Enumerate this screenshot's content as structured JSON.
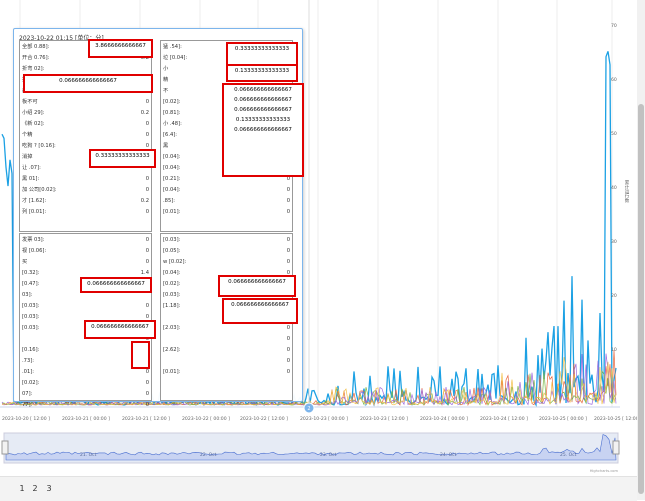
{
  "tooltip": {
    "header": "2023-10-22 01:15 [单位：分]",
    "tables": [
      {
        "rows": [
          {
            "label": "全部",
            "suffix": "0.88]:",
            "value": ""
          },
          {
            "label": "开合",
            "suffix": "0.76]:",
            "value": "0.2"
          },
          {
            "label": "折弯",
            "suffix": "02]:",
            "value": ""
          },
          {
            "label": "拒绝",
            "suffix": "0.02]:",
            "value": ""
          },
          {
            "label": "疯狂",
            "suffix": "32]:",
            "value": "0"
          },
          {
            "label": "板不可",
            "suffix": "",
            "value": "0"
          },
          {
            "label": "小绍",
            "suffix": "29]:",
            "value": "0.2"
          },
          {
            "label": "《新",
            "suffix": "02]:",
            "value": "0"
          },
          {
            "label": "个精",
            "suffix": "",
            "value": "0"
          },
          {
            "label": "吃狗",
            "suffix": "? [0.16]:",
            "value": "0"
          },
          {
            "label": "消掉",
            "suffix": "",
            "value": "0"
          },
          {
            "label": "让",
            "suffix": ".07]:",
            "value": ""
          },
          {
            "label": "黑",
            "suffix": "01]:",
            "value": "0"
          },
          {
            "label": "加",
            "suffix": "公司[0.02]:",
            "value": "0"
          },
          {
            "label": "才",
            "suffix": "[1.62]:",
            "value": "0.2"
          },
          {
            "label": "列",
            "suffix": "[0.01]:",
            "value": "0"
          }
        ]
      },
      {
        "rows": [
          {
            "label": "猛",
            "suffix": ".54]:",
            "value": ""
          },
          {
            "label": "垃",
            "suffix": "[0.04]:",
            "value": ""
          },
          {
            "label": "小",
            "suffix": "",
            "value": ""
          },
          {
            "label": "精",
            "suffix": "",
            "value": ""
          },
          {
            "label": "不",
            "suffix": "",
            "value": ""
          },
          {
            "label": "",
            "suffix": "[0.02]:",
            "value": ""
          },
          {
            "label": "",
            "suffix": "[0.81]:",
            "value": ""
          },
          {
            "label": "小",
            "suffix": ".48]:",
            "value": ""
          },
          {
            "label": "",
            "suffix": "[6.4]:",
            "value": ""
          },
          {
            "label": "黑",
            "suffix": "",
            "value": ""
          },
          {
            "label": "",
            "suffix": "[0.04]:",
            "value": "0"
          },
          {
            "label": "",
            "suffix": "[0.04]:",
            "value": "0"
          },
          {
            "label": "",
            "suffix": "[0.21]:",
            "value": "0"
          },
          {
            "label": "",
            "suffix": "[0.04]:",
            "value": "0"
          },
          {
            "label": "",
            "suffix": ".85]:",
            "value": "0"
          },
          {
            "label": "",
            "suffix": "[0.01]:",
            "value": "0"
          }
        ]
      },
      {
        "rows": [
          {
            "label": "发票",
            "suffix": "03]:",
            "value": "0"
          },
          {
            "label": "视",
            "suffix": "[0.06]:",
            "value": "0"
          },
          {
            "label": "买",
            "suffix": "",
            "value": "0"
          },
          {
            "label": "",
            "suffix": "[0.32]:",
            "value": "1.4"
          },
          {
            "label": "",
            "suffix": "[0.47]:",
            "value": ""
          },
          {
            "label": "",
            "suffix": "03]:",
            "value": ""
          },
          {
            "label": "",
            "suffix": "[0.03]:",
            "value": "0"
          },
          {
            "label": "",
            "suffix": "[0.03]:",
            "value": "0"
          },
          {
            "label": "",
            "suffix": "[0.03]:",
            "value": ""
          },
          {
            "label": "",
            "suffix": "",
            "value": "0"
          },
          {
            "label": "",
            "suffix": "[0.16]:",
            "value": "0.2"
          },
          {
            "label": "",
            "suffix": ".73]:",
            "value": "0.2"
          },
          {
            "label": "",
            "suffix": ".01]:",
            "value": "0"
          },
          {
            "label": "",
            "suffix": "[0.02]:",
            "value": "0"
          },
          {
            "label": "",
            "suffix": "07]:",
            "value": "0"
          },
          {
            "label": "",
            "suffix": "77]:",
            "value": "0"
          }
        ]
      },
      {
        "rows": [
          {
            "label": "",
            "suffix": "[0.03]:",
            "value": "0"
          },
          {
            "label": "",
            "suffix": "[0.05]:",
            "value": "0"
          },
          {
            "label": "",
            "suffix": "w [0.02]:",
            "value": "0"
          },
          {
            "label": "",
            "suffix": "[0.04]:",
            "value": "0"
          },
          {
            "label": "",
            "suffix": "[0.02]:",
            "value": ""
          },
          {
            "label": "",
            "suffix": "[0.03]:",
            "value": ""
          },
          {
            "label": "",
            "suffix": "[1.18]:",
            "value": ""
          },
          {
            "label": "",
            "suffix": "",
            "value": ""
          },
          {
            "label": "",
            "suffix": "[2.03]:",
            "value": "0"
          },
          {
            "label": "",
            "suffix": "",
            "value": "0"
          },
          {
            "label": "",
            "suffix": "[2.62]:",
            "value": "0"
          },
          {
            "label": "",
            "suffix": "",
            "value": "0"
          },
          {
            "label": "",
            "suffix": "[0.01]:",
            "value": "0"
          }
        ]
      }
    ],
    "highlights": [
      "3.8666666666667",
      "0.066666666666667",
      "0.33333333333333",
      "0.33333333333333",
      "0.13333333333333",
      "0.066666666666667",
      "0.066666666666667",
      "0.066666666666667",
      "0.13333333333333",
      "0.066666666666667",
      "0.066666666666667",
      "0.066666666666667",
      "0.066666666666667",
      "0.066666666666667"
    ]
  },
  "chart": {
    "x_ticks": [
      "2023-10-20 [ 12:00 ]",
      "2023-10-21 [ 00:00 ]",
      "2023-10-21 [ 12:00 ]",
      "2023-10-22 [ 00:00 ]",
      "2023-10-22 [ 12:00 ]",
      "2023-10-23 [ 00:00 ]",
      "2023-10-23 [ 12:00 ]",
      "2023-10-24 [ 00:00 ]",
      "2023-10-24 [ 12:00 ]",
      "2023-10-25 [ 00:00 ]",
      "2023-10-25 [ 12:00 ]"
    ],
    "y_ticks": [
      "70",
      "60",
      "50",
      "40",
      "30",
      "20",
      "10"
    ],
    "y_title": "累计运行数",
    "nav_labels": [
      "21. Oct",
      "22. Oct",
      "23. Oct",
      "24. Oct",
      "25. Oct"
    ],
    "credits": "Highcharts.com",
    "marker_label": "2",
    "series_colors": [
      "#1ca1e4",
      "#e8683f",
      "#7ab648",
      "#9c6ade",
      "#f2c14e"
    ]
  },
  "pager": {
    "pages": [
      "1",
      "2",
      "3"
    ]
  }
}
